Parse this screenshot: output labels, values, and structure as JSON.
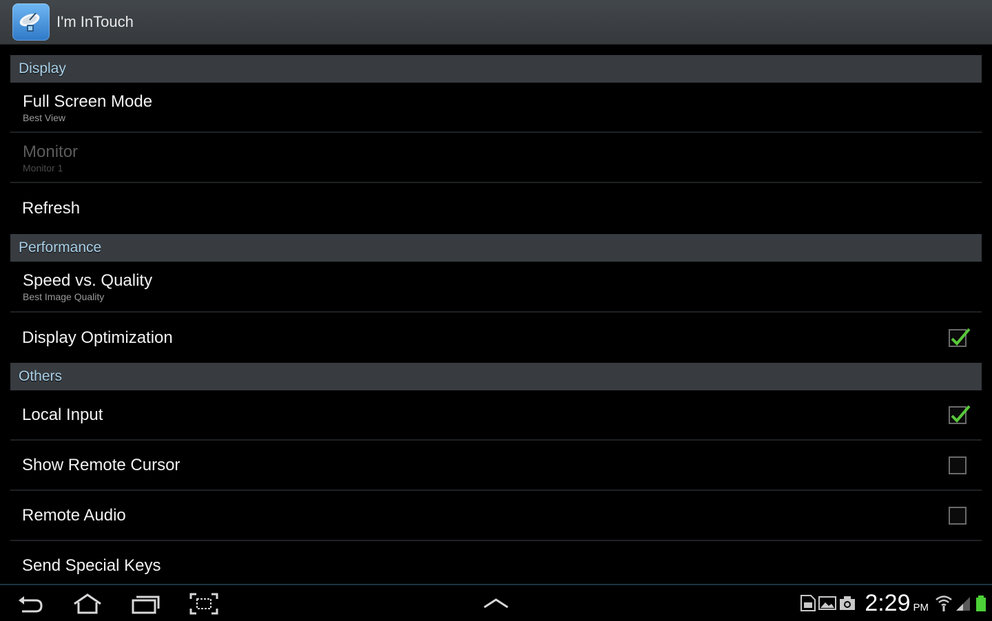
{
  "app": {
    "title": "I'm InTouch",
    "icon": "satellite-dish-icon"
  },
  "sections": {
    "display": {
      "header": "Display",
      "full_screen_title": "Full Screen Mode",
      "full_screen_sub": "Best View",
      "monitor_title": "Monitor",
      "monitor_sub": "Monitor 1",
      "refresh_title": "Refresh"
    },
    "performance": {
      "header": "Performance",
      "speed_title": "Speed vs. Quality",
      "speed_sub": "Best Image Quality",
      "optimization_title": "Display Optimization",
      "optimization_checked": true
    },
    "others": {
      "header": "Others",
      "local_input_title": "Local Input",
      "local_input_checked": true,
      "remote_cursor_title": "Show Remote Cursor",
      "remote_cursor_checked": false,
      "remote_audio_title": "Remote Audio",
      "remote_audio_checked": false,
      "special_keys_title": "Send Special Keys"
    }
  },
  "navbar": {
    "buttons": [
      "back-icon",
      "home-icon",
      "recent-apps-icon",
      "screenshot-icon",
      "up-chevron-icon"
    ]
  },
  "status": {
    "time": "2:29",
    "ampm": "PM",
    "icons": [
      "sd-card-icon",
      "gallery-icon",
      "camera-icon",
      "wifi-icon",
      "signal-icon",
      "battery-icon"
    ]
  },
  "colors": {
    "section_header_bg": "#383c40",
    "section_header_text": "#a9d0e8",
    "check_green": "#58c93a",
    "battery_green": "#4cd137"
  }
}
